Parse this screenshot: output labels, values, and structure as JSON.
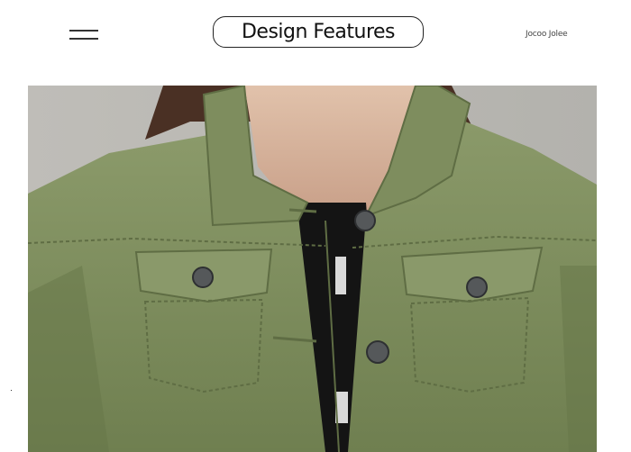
{
  "header": {
    "menu_icon": "hamburger-menu-icon",
    "title": "Design Features",
    "brand": "Jocoo Jolee"
  },
  "product_photo": {
    "subject": "olive green denim jacket close-up",
    "colors": {
      "background": "#b9b8b3",
      "jacket": "#7d8c5c",
      "jacket_shadow": "#5f6d44",
      "shirt": "#141414",
      "hair": "#4a3024",
      "skin": "#d8b7a0"
    }
  }
}
